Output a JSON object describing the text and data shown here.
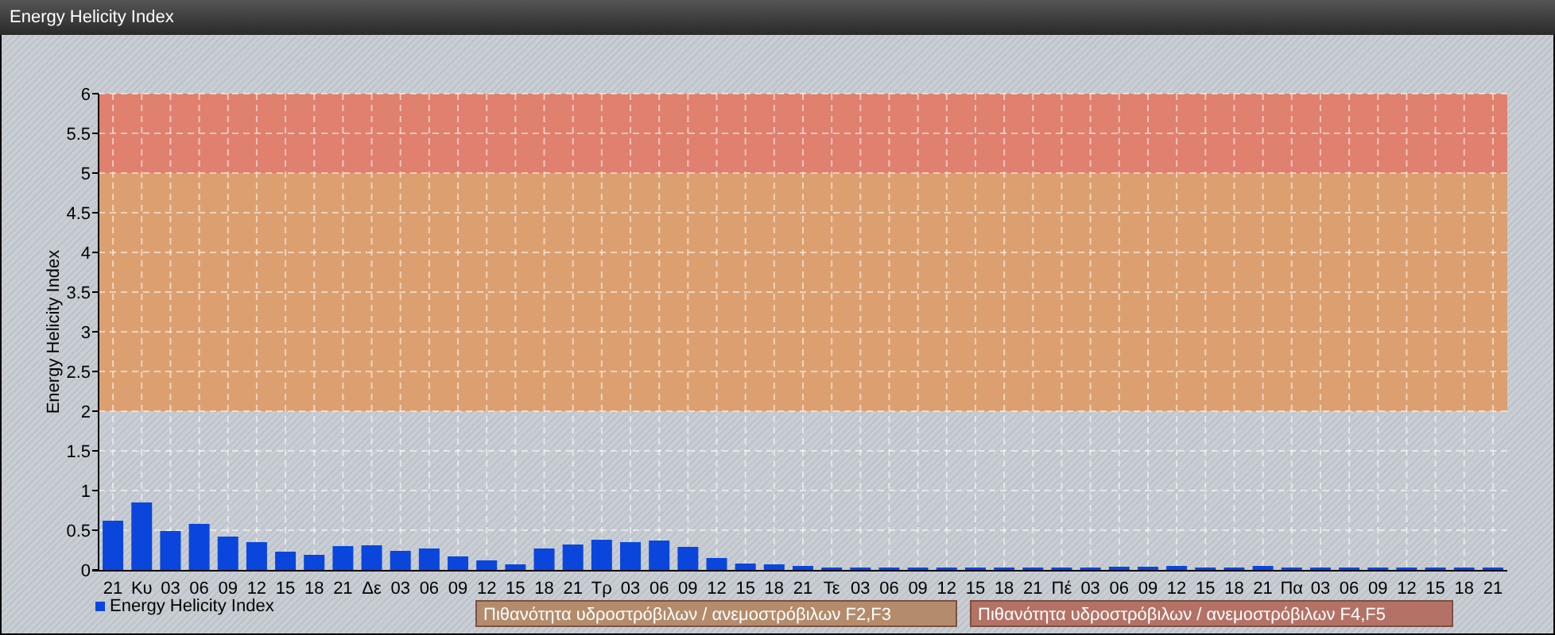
{
  "window": {
    "title": "Energy Helicity Index"
  },
  "chart": {
    "chart_data": {
      "type": "bar",
      "ylabel": "Energy Helicity Index",
      "categories": [
        "21",
        "Κυ",
        "03",
        "06",
        "09",
        "12",
        "15",
        "18",
        "21",
        "Δε",
        "03",
        "06",
        "09",
        "12",
        "15",
        "18",
        "21",
        "Τρ",
        "03",
        "06",
        "09",
        "12",
        "15",
        "18",
        "21",
        "Τε",
        "03",
        "06",
        "09",
        "12",
        "15",
        "18",
        "21",
        "Πέ",
        "03",
        "06",
        "09",
        "12",
        "15",
        "18",
        "21",
        "Πα",
        "03",
        "06",
        "09",
        "12",
        "15",
        "18",
        "21"
      ],
      "series": [
        {
          "name": "Energy Helicity Index",
          "color": "#0a46dc",
          "values": [
            0.62,
            0.85,
            0.49,
            0.58,
            0.42,
            0.35,
            0.23,
            0.19,
            0.3,
            0.31,
            0.24,
            0.27,
            0.17,
            0.12,
            0.07,
            0.27,
            0.32,
            0.38,
            0.35,
            0.37,
            0.29,
            0.15,
            0.08,
            0.07,
            0.05,
            0.03,
            0.02,
            0.02,
            0.02,
            0.02,
            0.03,
            0.02,
            0.03,
            0.02,
            0.02,
            0.04,
            0.04,
            0.05,
            0.03,
            0.03,
            0.05,
            0.02,
            0.02,
            0.02,
            0.02,
            0.02,
            0.02,
            0.03,
            0.02
          ]
        }
      ],
      "ylim": [
        0,
        6
      ],
      "yticks": [
        {
          "value": 0,
          "label": "0"
        },
        {
          "value": 0.5,
          "label": "0.5"
        },
        {
          "value": 1,
          "label": "1"
        },
        {
          "value": 1.5,
          "label": "1.5"
        },
        {
          "value": 2,
          "label": "2"
        },
        {
          "value": 2.5,
          "label": "2.5"
        },
        {
          "value": 3,
          "label": "3"
        },
        {
          "value": 3.5,
          "label": "3.5"
        },
        {
          "value": 4,
          "label": "4"
        },
        {
          "value": 4.5,
          "label": "4.5"
        },
        {
          "value": 5,
          "label": "5"
        },
        {
          "value": 5.5,
          "label": "5.5"
        },
        {
          "value": 6,
          "label": "6"
        }
      ],
      "grid": true,
      "bands": [
        {
          "axis": "y",
          "from": 2,
          "to": 5,
          "color": "#dca070"
        },
        {
          "axis": "y",
          "from": 5,
          "to": 6,
          "color": "#e0806e"
        }
      ]
    },
    "band_legend": [
      {
        "label": "Πιθανότητα υδροστρόβιλων / ανεμοστρόβιλων F2,F3",
        "color": "#b48c6c"
      },
      {
        "label": "Πιθανότητα υδροστρόβιλων / ανεμοστρόβιλων F4,F5",
        "color": "#b47266"
      }
    ]
  }
}
